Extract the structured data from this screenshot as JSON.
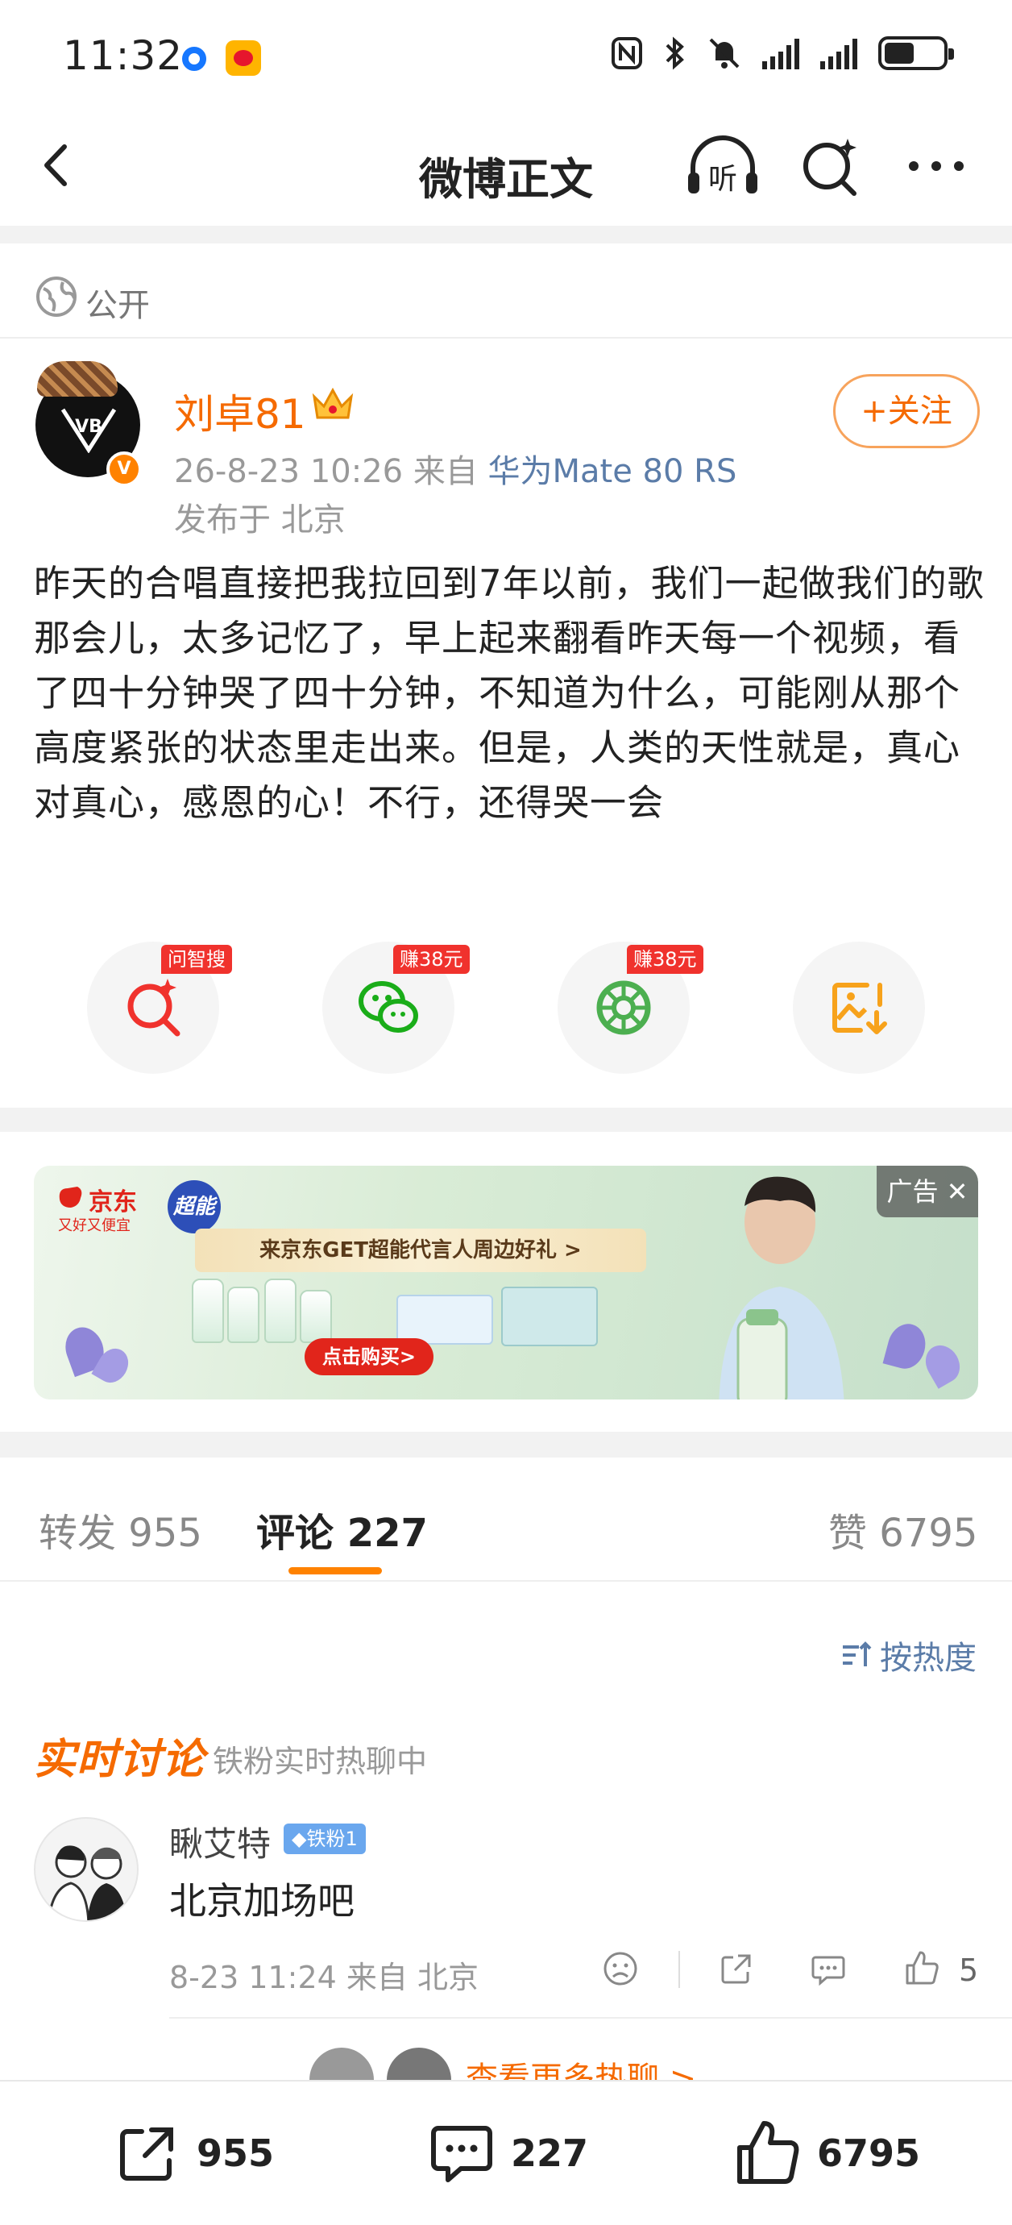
{
  "status_bar": {
    "time": "11:32",
    "icons": [
      "location-dot-icon",
      "weibo-app-icon",
      "nfc-icon",
      "bluetooth-icon",
      "mute-icon",
      "signal-icon",
      "signal-icon",
      "battery-icon"
    ]
  },
  "nav": {
    "title": "微博正文",
    "listen_label": "听",
    "icons": [
      "back-icon",
      "listen-icon",
      "search-icon",
      "more-icon"
    ]
  },
  "visibility": "公开",
  "post": {
    "author": "刘卓81",
    "verified_badge": "V",
    "follow_label": "+关注",
    "time_source_prefix": "26-8-23 10:26  来自 ",
    "device": "华为Mate 80 RS",
    "location": "发布于 北京",
    "text": "昨天的合唱直接把我拉回到7年以前，我们一起做我们的歌那会儿，太多记忆了，早上起来翻看昨天每一个视频，看了四十分钟哭了四十分钟，不知道为什么，可能刚从那个高度紧张的状态里走出来。但是，人类的天性就是，真心对真心，感恩的心！不行，还得哭一会"
  },
  "actions": [
    {
      "icon": "ai-search-icon",
      "tag": "问智搜"
    },
    {
      "icon": "wechat-icon",
      "tag": "赚38元"
    },
    {
      "icon": "moments-icon",
      "tag": "赚38元"
    },
    {
      "icon": "save-image-icon",
      "tag": ""
    }
  ],
  "ad": {
    "label": "广告 ✕",
    "jd_name": "京东",
    "jd_slogan": "又好又便宜",
    "brand": "超能",
    "banner": "来京东GET超能代言人周边好礼 >",
    "buy": "点击购买>"
  },
  "tabs": {
    "repost": "转发 955",
    "comment": "评论 227",
    "like": "赞 6795"
  },
  "sort_label": "按热度",
  "realtime": {
    "title": "实时讨论",
    "subtitle": "铁粉实时热聊中"
  },
  "comment": {
    "user": "瞅艾特",
    "badge": "◆铁粉1",
    "text": "北京加场吧",
    "meta": "8-23 11:24  来自 北京",
    "likes": "5"
  },
  "more_link": "查看更多热聊 >",
  "bottom": {
    "repost": "955",
    "comment": "227",
    "like": "6795"
  },
  "colors": {
    "accent": "#ff8200",
    "name_orange": "#f56a00",
    "link_blue": "#5b7ca8",
    "tag_red": "#f0322d"
  }
}
